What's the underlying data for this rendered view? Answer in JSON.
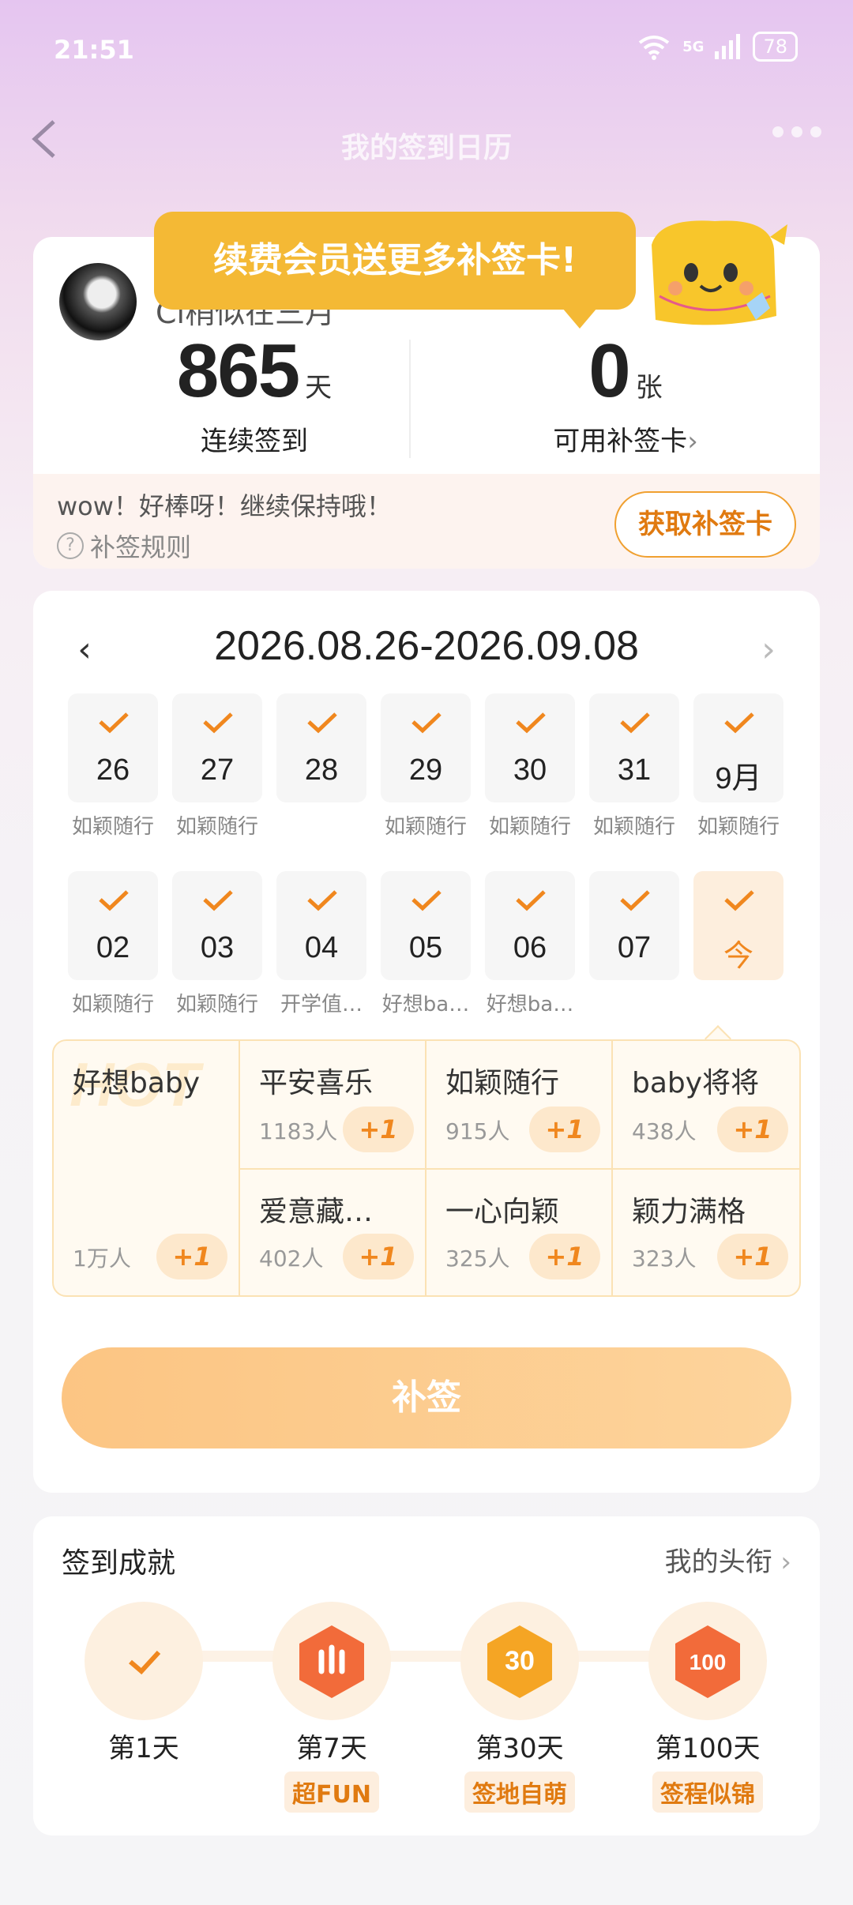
{
  "status_bar": {
    "time": "21:51",
    "network": "5G",
    "battery": "78"
  },
  "header": {
    "title": "我的签到日历"
  },
  "profile": {
    "username": "Ci稍似在三月",
    "streak_days": "865",
    "streak_unit": "天",
    "streak_label": "连续签到",
    "cards": "0",
    "cards_unit": "张",
    "cards_label": "可用补签卡",
    "encourage": "wow！好棒呀！继续保持哦！",
    "rules_label": "补签规则",
    "get_card_label": "获取补签卡",
    "tooltip": "续费会员送更多补签卡!"
  },
  "calendar": {
    "range": "2026.08.26-2026.09.08",
    "week1": [
      {
        "num": "26",
        "tag": "如颖随行"
      },
      {
        "num": "27",
        "tag": "如颖随行"
      },
      {
        "num": "28",
        "tag": ""
      },
      {
        "num": "29",
        "tag": "如颖随行"
      },
      {
        "num": "30",
        "tag": "如颖随行"
      },
      {
        "num": "31",
        "tag": "如颖随行"
      },
      {
        "num": "9月",
        "tag": "如颖随行"
      }
    ],
    "week2": [
      {
        "num": "02",
        "tag": "如颖随行"
      },
      {
        "num": "03",
        "tag": "如颖随行"
      },
      {
        "num": "04",
        "tag": "开学值…"
      },
      {
        "num": "05",
        "tag": "好想ba…"
      },
      {
        "num": "06",
        "tag": "好想ba…"
      },
      {
        "num": "07",
        "tag": ""
      },
      {
        "num": "今",
        "tag": ""
      }
    ]
  },
  "tags": {
    "hot_watermark": "HOT",
    "hot": {
      "name": "好想baby",
      "count": "1万人",
      "plus": "+1"
    },
    "cells": [
      {
        "name": "平安喜乐",
        "count": "1183人",
        "plus": "+1"
      },
      {
        "name": "如颖随行",
        "count": "915人",
        "plus": "+1"
      },
      {
        "name": "baby将将",
        "count": "438人",
        "plus": "+1"
      },
      {
        "name": "爱意藏…",
        "count": "402人",
        "plus": "+1"
      },
      {
        "name": "一心向颖",
        "count": "325人",
        "plus": "+1"
      },
      {
        "name": "颖力满格",
        "count": "323人",
        "plus": "+1"
      }
    ]
  },
  "makeup_button": "补签",
  "achievements": {
    "title": "签到成就",
    "my_titles": "我的头衔",
    "badges": [
      {
        "day": "第1天",
        "name": ""
      },
      {
        "day": "第7天",
        "name": "超FUN"
      },
      {
        "day": "第30天",
        "name": "签地自萌"
      },
      {
        "day": "第100天",
        "name": "签程似锦"
      }
    ]
  },
  "colors": {
    "accent": "#f0871e",
    "tooltip": "#f4b935",
    "button": "#fdc98b"
  }
}
